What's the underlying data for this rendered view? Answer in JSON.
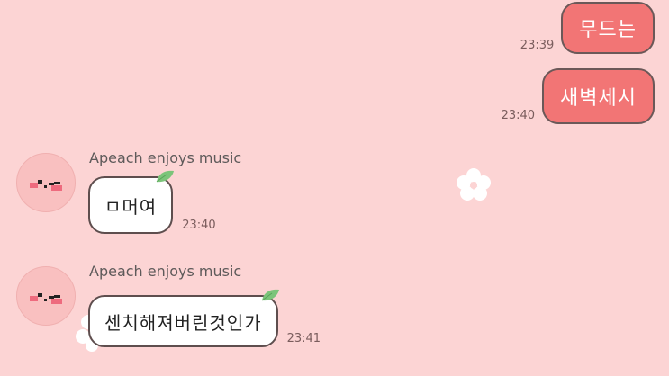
{
  "sent_messages": [
    {
      "text": "무드는",
      "time": "23:39"
    },
    {
      "text": "새벽세시",
      "time": "23:40"
    }
  ],
  "received_messages": [
    {
      "sender": "Apeach enjoys music",
      "text": "ㅁ머여",
      "time": "23:40"
    },
    {
      "sender": "Apeach enjoys music",
      "text": "센치해져버린것인가",
      "time": "23:41"
    }
  ],
  "colors": {
    "background": "#fcd4d4",
    "sent_bubble": "#f27575",
    "received_bubble": "#ffffff",
    "leaf": "#7cc47a"
  },
  "icons": {
    "avatar": "apeach-avatar-icon",
    "leaf": "leaf-icon",
    "flower": "flower-icon"
  }
}
